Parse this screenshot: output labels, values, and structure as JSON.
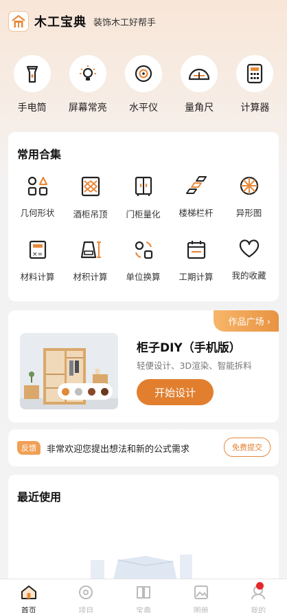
{
  "header": {
    "brand": "木工宝典",
    "slogan": "装饰木工好帮手",
    "logo": "house-logo-icon"
  },
  "tools": [
    {
      "label": "手电筒",
      "icon": "flashlight-icon"
    },
    {
      "label": "屏幕常亮",
      "icon": "lightbulb-icon"
    },
    {
      "label": "水平仪",
      "icon": "level-icon"
    },
    {
      "label": "量角尺",
      "icon": "protractor-icon"
    },
    {
      "label": "计算器",
      "icon": "calculator-icon"
    }
  ],
  "collection": {
    "title": "常用合集",
    "items": [
      {
        "label": "几何形状",
        "icon": "geometry-icon"
      },
      {
        "label": "酒柜吊顶",
        "icon": "wine-cabinet-icon"
      },
      {
        "label": "门柜量化",
        "icon": "door-cabinet-icon"
      },
      {
        "label": "楼梯栏杆",
        "icon": "stairs-icon"
      },
      {
        "label": "异形图",
        "icon": "special-shape-icon"
      },
      {
        "label": "材料计算",
        "icon": "material-calc-icon"
      },
      {
        "label": "材积计算",
        "icon": "volume-calc-icon"
      },
      {
        "label": "单位换算",
        "icon": "unit-convert-icon"
      },
      {
        "label": "工期计算",
        "icon": "schedule-icon"
      },
      {
        "label": "我的收藏",
        "icon": "heart-icon"
      }
    ]
  },
  "promo": {
    "ribbon": "作品广场",
    "name": "柜子DIY（手机版）",
    "desc": "轻便设计、3D渲染、智能拆料",
    "button": "开始设计",
    "swatches": [
      "#e08a3a",
      "#bfbfbf",
      "#8a4a2a",
      "#6a3a1e"
    ]
  },
  "feedback": {
    "tag": "反馈",
    "text": "非常欢迎您提出想法和新的公式需求",
    "button": "免费提交"
  },
  "recent": {
    "title": "最近使用"
  },
  "tabbar": [
    {
      "label": "首页",
      "icon": "home-icon",
      "active": true
    },
    {
      "label": "项目",
      "icon": "project-icon"
    },
    {
      "label": "宝典",
      "icon": "book-icon"
    },
    {
      "label": "图册",
      "icon": "gallery-icon"
    },
    {
      "label": "我的",
      "icon": "profile-icon"
    }
  ],
  "colors": {
    "accent": "#e17f2f",
    "badge": "#e5282b"
  }
}
